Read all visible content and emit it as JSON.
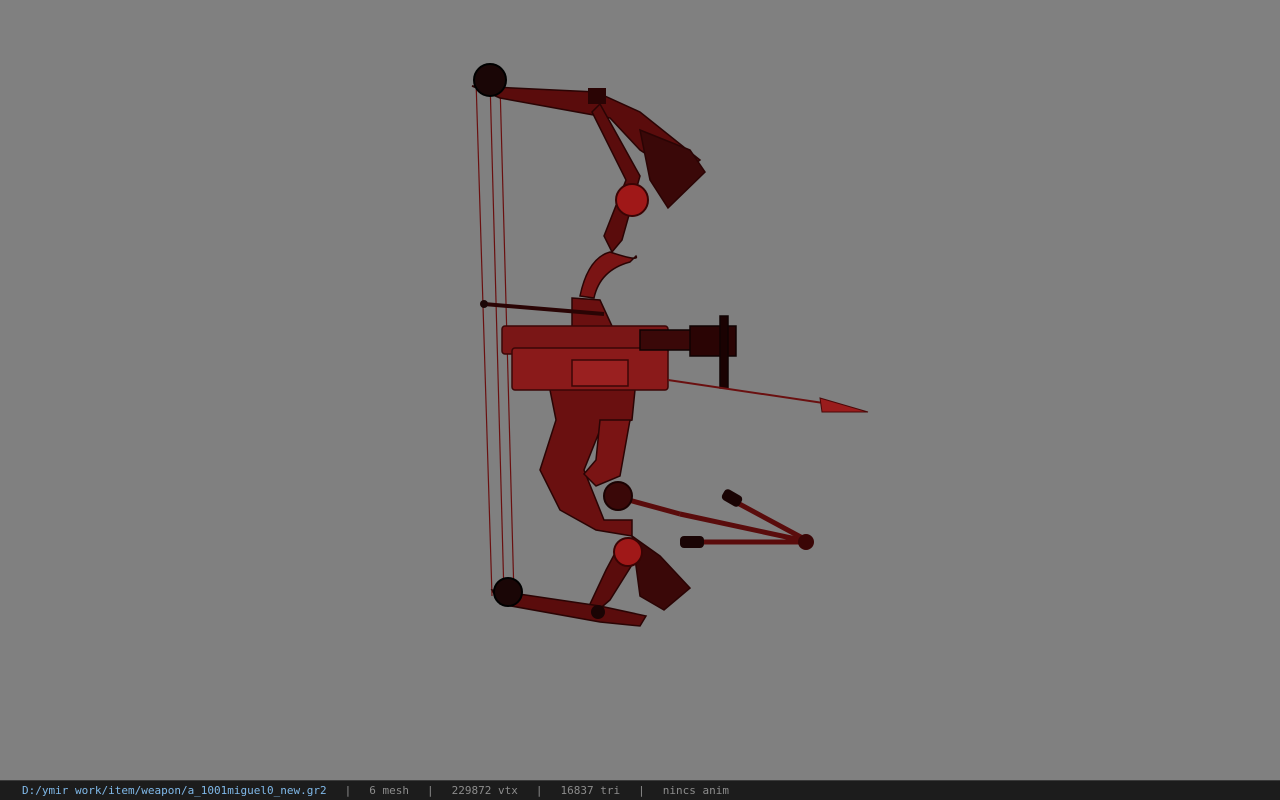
{
  "viewer": {
    "background_color": "#808080",
    "model_icon": "compound-bow-model",
    "model_tint": "#7a1a1a"
  },
  "status": {
    "path": "D:/ymir work/item/weapon/a_1001miguel0_new.gr2",
    "mesh": "6 mesh",
    "vtx": "229872 vtx",
    "tri": "16837 tri",
    "anim": "nincs anim",
    "separator": "|"
  }
}
